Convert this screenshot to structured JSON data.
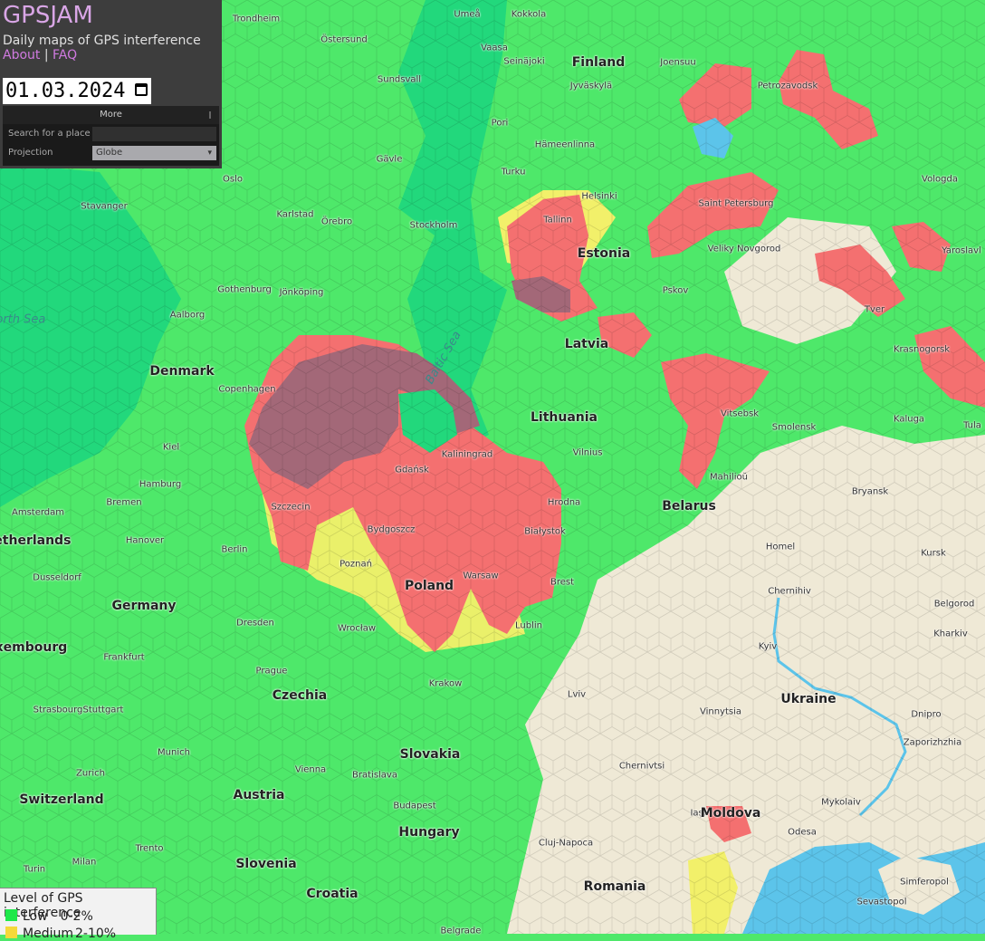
{
  "app": {
    "title": "GPSJAM",
    "subtitle": "Daily maps of GPS interference",
    "links": [
      {
        "label": "About"
      },
      {
        "label": "FAQ"
      }
    ],
    "link_separator": "|",
    "date_value": "01.03.2024"
  },
  "controls": {
    "more_label": "More",
    "search_label": "Search for a place",
    "search_value": "",
    "projection_label": "Projection",
    "projection_value": "Globe"
  },
  "legend": {
    "title": "Level of GPS interference",
    "items": [
      {
        "label": "Low",
        "range": "0-2%",
        "color": "#1ee84a"
      },
      {
        "label": "Medium",
        "range": "2-10%",
        "color": "#f5d93a"
      }
    ]
  },
  "colors": {
    "low": "#4ee86a",
    "medium": "#f2f06a",
    "high": "#f47070",
    "very_high": "#a36878",
    "sea": "#22d87c",
    "water": "#5cc4ea",
    "land_nodata": "#efe9d6"
  },
  "places": [
    {
      "name": "Trondheim"
    },
    {
      "name": "Östersund"
    },
    {
      "name": "Umeå"
    },
    {
      "name": "Kokkola"
    },
    {
      "name": "Vaasa"
    },
    {
      "name": "Seinäjoki"
    },
    {
      "name": "Finland",
      "type": "country"
    },
    {
      "name": "Joensuu"
    },
    {
      "name": "Sundsvall"
    },
    {
      "name": "Jyväskylä"
    },
    {
      "name": "Petrozavodsk"
    },
    {
      "name": "Pori"
    },
    {
      "name": "Hämeenlinna"
    },
    {
      "name": "Gävle"
    },
    {
      "name": "Turku"
    },
    {
      "name": "Oslo"
    },
    {
      "name": "Helsinki"
    },
    {
      "name": "Saint Petersburg"
    },
    {
      "name": "Vologda"
    },
    {
      "name": "Stavanger"
    },
    {
      "name": "Karlstad"
    },
    {
      "name": "Örebro"
    },
    {
      "name": "Stockholm"
    },
    {
      "name": "Tallinn"
    },
    {
      "name": "Estonia",
      "type": "country"
    },
    {
      "name": "Veliky Novgorod"
    },
    {
      "name": "Yaroslavl"
    },
    {
      "name": "Gothenburg"
    },
    {
      "name": "Jönköping"
    },
    {
      "name": "Pskov"
    },
    {
      "name": "Aalborg"
    },
    {
      "name": "Tver"
    },
    {
      "name": "Latvia",
      "type": "country"
    },
    {
      "name": "Krasnogorsk"
    },
    {
      "name": "Denmark",
      "type": "country"
    },
    {
      "name": "Copenhagen"
    },
    {
      "name": "Baltic Sea",
      "type": "sea"
    },
    {
      "name": "Lithuania",
      "type": "country"
    },
    {
      "name": "Vitsebsk"
    },
    {
      "name": "Smolensk"
    },
    {
      "name": "Kaluga"
    },
    {
      "name": "Tula"
    },
    {
      "name": "Kiel"
    },
    {
      "name": "Kaliningrad"
    },
    {
      "name": "Vilnius"
    },
    {
      "name": "Gdańsk"
    },
    {
      "name": "Mahilioŭ"
    },
    {
      "name": "Hamburg"
    },
    {
      "name": "Bremen"
    },
    {
      "name": "Amsterdam"
    },
    {
      "name": "Szczecin"
    },
    {
      "name": "Hrodna"
    },
    {
      "name": "Belarus",
      "type": "country"
    },
    {
      "name": "Bryansk"
    },
    {
      "name": "Netherlands",
      "type": "country"
    },
    {
      "name": "Hanover"
    },
    {
      "name": "Bydgoszcz"
    },
    {
      "name": "Białystok"
    },
    {
      "name": "Berlin"
    },
    {
      "name": "Poznań"
    },
    {
      "name": "Homel"
    },
    {
      "name": "Kursk"
    },
    {
      "name": "Dusseldorf"
    },
    {
      "name": "Warsaw"
    },
    {
      "name": "Brest"
    },
    {
      "name": "Poland",
      "type": "country"
    },
    {
      "name": "Chernihiv"
    },
    {
      "name": "Belgorod"
    },
    {
      "name": "Germany",
      "type": "country"
    },
    {
      "name": "Dresden"
    },
    {
      "name": "Wrocław"
    },
    {
      "name": "Lublin"
    },
    {
      "name": "Kharkiv"
    },
    {
      "name": "Luxembourg",
      "type": "country"
    },
    {
      "name": "Frankfurt"
    },
    {
      "name": "Kyiv"
    },
    {
      "name": "Prague"
    },
    {
      "name": "Krakow"
    },
    {
      "name": "Czechia",
      "type": "country"
    },
    {
      "name": "Lviv"
    },
    {
      "name": "Ukraine",
      "type": "country"
    },
    {
      "name": "Strasbourg"
    },
    {
      "name": "Stuttgart"
    },
    {
      "name": "Vinnytsia"
    },
    {
      "name": "Dnipro"
    },
    {
      "name": "Munich"
    },
    {
      "name": "Slovakia",
      "type": "country"
    },
    {
      "name": "Zaporizhzhia"
    },
    {
      "name": "Zurich"
    },
    {
      "name": "Vienna"
    },
    {
      "name": "Bratislava"
    },
    {
      "name": "Chernivtsi"
    },
    {
      "name": "Switzerland",
      "type": "country"
    },
    {
      "name": "Austria",
      "type": "country"
    },
    {
      "name": "Budapest"
    },
    {
      "name": "Iași"
    },
    {
      "name": "Moldova",
      "type": "country"
    },
    {
      "name": "Mykolaiv"
    },
    {
      "name": "Hungary",
      "type": "country"
    },
    {
      "name": "Odesa"
    },
    {
      "name": "Cluj-Napoca"
    },
    {
      "name": "Trento"
    },
    {
      "name": "Milan"
    },
    {
      "name": "Slovenia",
      "type": "country"
    },
    {
      "name": "Turin"
    },
    {
      "name": "Romania",
      "type": "country"
    },
    {
      "name": "Croatia",
      "type": "country"
    },
    {
      "name": "Simferopol"
    },
    {
      "name": "Sevastopol"
    },
    {
      "name": "Belgrade"
    },
    {
      "name": "North Sea",
      "type": "sea"
    }
  ]
}
